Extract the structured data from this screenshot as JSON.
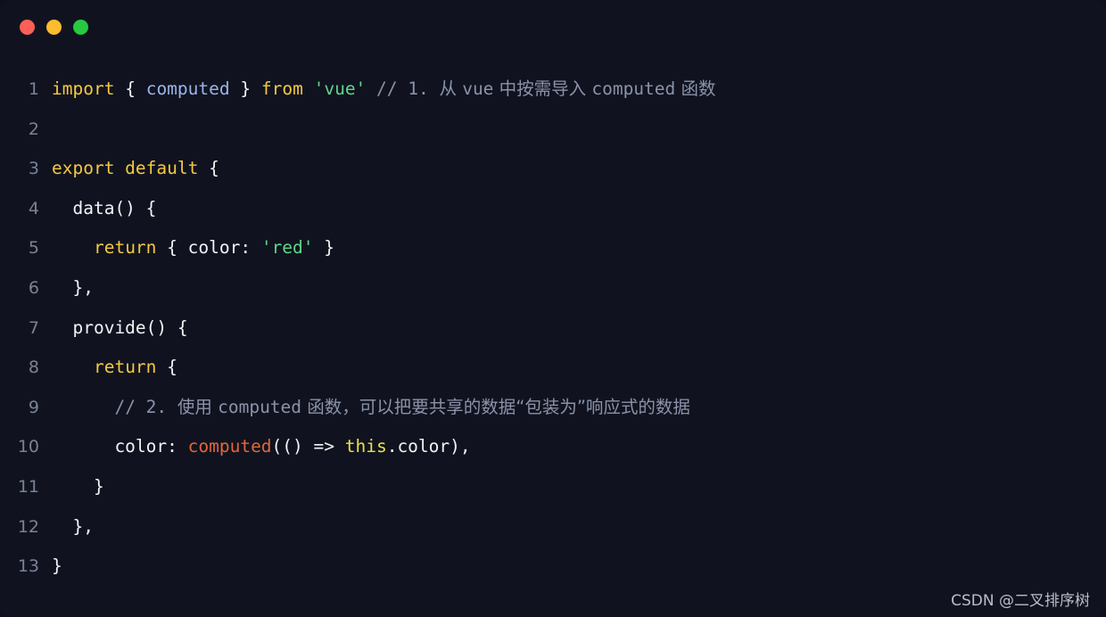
{
  "window": {
    "background": "#10131f",
    "page_background": "#0d1020",
    "traffic_lights": [
      {
        "name": "close",
        "color": "#ff5f57"
      },
      {
        "name": "minimize",
        "color": "#febc2e"
      },
      {
        "name": "maximize",
        "color": "#28c840"
      }
    ]
  },
  "colors": {
    "keyword": "#f5c842",
    "import_binding": "#9cb4e8",
    "string": "#5fd68a",
    "comment": "#8b92a8",
    "function": "#e0673a",
    "this_keyword": "#e8e04a",
    "plain": "#f2f3f7",
    "line_number": "#7b8296"
  },
  "code": {
    "language": "javascript",
    "line_count": 13,
    "lines": [
      {
        "number": "1",
        "text": "import { computed } from 'vue' // 1. 从 vue 中按需导入 computed 函数",
        "tokens": [
          {
            "t": "import",
            "c": "t-kw"
          },
          {
            "t": " ",
            "c": "t-pl"
          },
          {
            "t": "{",
            "c": "t-pl"
          },
          {
            "t": " ",
            "c": "t-pl"
          },
          {
            "t": "computed",
            "c": "t-imp"
          },
          {
            "t": " ",
            "c": "t-pl"
          },
          {
            "t": "}",
            "c": "t-pl"
          },
          {
            "t": " ",
            "c": "t-pl"
          },
          {
            "t": "from",
            "c": "t-kw"
          },
          {
            "t": " ",
            "c": "t-pl"
          },
          {
            "t": "'vue'",
            "c": "t-str"
          },
          {
            "t": " ",
            "c": "t-pl"
          },
          {
            "t": "// 1. ",
            "c": "t-com"
          },
          {
            "t": "从 ",
            "c": "t-com cjk"
          },
          {
            "t": "vue",
            "c": "t-com"
          },
          {
            "t": " 中按需导入 ",
            "c": "t-com cjk"
          },
          {
            "t": "computed",
            "c": "t-com"
          },
          {
            "t": " 函数",
            "c": "t-com cjk"
          }
        ]
      },
      {
        "number": "2",
        "text": "",
        "tokens": []
      },
      {
        "number": "3",
        "text": "export default {",
        "tokens": [
          {
            "t": "export default",
            "c": "t-kw"
          },
          {
            "t": " {",
            "c": "t-pl"
          }
        ]
      },
      {
        "number": "4",
        "text": "  data() {",
        "tokens": [
          {
            "t": "  data() {",
            "c": "t-pl"
          }
        ]
      },
      {
        "number": "5",
        "text": "    return { color: 'red' }",
        "tokens": [
          {
            "t": "    ",
            "c": "t-pl"
          },
          {
            "t": "return",
            "c": "t-kw"
          },
          {
            "t": " { color: ",
            "c": "t-pl"
          },
          {
            "t": "'red'",
            "c": "t-str"
          },
          {
            "t": " }",
            "c": "t-pl"
          }
        ]
      },
      {
        "number": "6",
        "text": "  },",
        "tokens": [
          {
            "t": "  },",
            "c": "t-pl"
          }
        ]
      },
      {
        "number": "7",
        "text": "  provide() {",
        "tokens": [
          {
            "t": "  provide() {",
            "c": "t-pl"
          }
        ]
      },
      {
        "number": "8",
        "text": "    return {",
        "tokens": [
          {
            "t": "    ",
            "c": "t-pl"
          },
          {
            "t": "return",
            "c": "t-kw"
          },
          {
            "t": " {",
            "c": "t-pl"
          }
        ]
      },
      {
        "number": "9",
        "text": "      // 2. 使用 computed 函数，可以把要共享的数据“包装为”响应式的数据",
        "tokens": [
          {
            "t": "      ",
            "c": "t-pl"
          },
          {
            "t": "// 2. ",
            "c": "t-com"
          },
          {
            "t": "使用 ",
            "c": "t-com cjk"
          },
          {
            "t": "computed",
            "c": "t-com"
          },
          {
            "t": " 函数，可以把要共享的数据“包装为”响应式的数据",
            "c": "t-com cjk"
          }
        ]
      },
      {
        "number": "10",
        "text": "      color: computed(() => this.color),",
        "tokens": [
          {
            "t": "      color: ",
            "c": "t-pl"
          },
          {
            "t": "computed",
            "c": "t-fn"
          },
          {
            "t": "(() => ",
            "c": "t-pl"
          },
          {
            "t": "this",
            "c": "t-this"
          },
          {
            "t": ".color),",
            "c": "t-pl"
          }
        ]
      },
      {
        "number": "11",
        "text": "    }",
        "tokens": [
          {
            "t": "    }",
            "c": "t-pl"
          }
        ]
      },
      {
        "number": "12",
        "text": "  },",
        "tokens": [
          {
            "t": "  },",
            "c": "t-pl"
          }
        ]
      },
      {
        "number": "13",
        "text": "}",
        "tokens": [
          {
            "t": "}",
            "c": "t-pl"
          }
        ]
      }
    ]
  },
  "watermark": {
    "text": "CSDN @二叉排序树"
  }
}
